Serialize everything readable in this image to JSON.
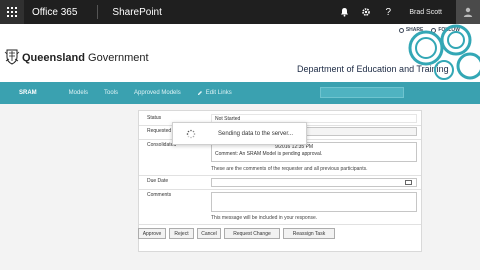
{
  "suite_bar": {
    "brand": "Office 365",
    "app": "SharePoint",
    "user": "Brad Scott",
    "icons": [
      "waffle-icon",
      "bell-icon",
      "gear-icon",
      "help-icon",
      "avatar-icon"
    ]
  },
  "header": {
    "share_label": "SHARE",
    "follow_label": "FOLLOW",
    "org_bold": "Queensland",
    "org_rest": " Government",
    "department": "Department of Education and Training"
  },
  "nav": {
    "items": [
      "SRAM",
      "Models",
      "Tools",
      "Approved Models"
    ],
    "edit_label": "Edit Links"
  },
  "form": {
    "status_label": "Status",
    "status_value": "Not Started",
    "requested_label": "Requested",
    "consolidated_label": "Consolidated",
    "comment_line1": "9/2016 12:35 PM",
    "comment_line2": "Comment: An SRAM Model is pending approval.",
    "comments_hint": "These are the comments of the requester and all previous participants.",
    "due_label": "Due Date",
    "comments_label": "Comments",
    "response_hint": "This message will be included in your response."
  },
  "buttons": {
    "approve": "Approve",
    "reject": "Reject",
    "cancel": "Cancel",
    "request_change": "Request Change",
    "reassign": "Reassign Task"
  },
  "modal": {
    "text": "Sending data to the server..."
  },
  "colors": {
    "suite_bar": "#1f1f1f",
    "nav_bar": "#3aa1b0",
    "accent_swirl": "#33a7b5"
  }
}
